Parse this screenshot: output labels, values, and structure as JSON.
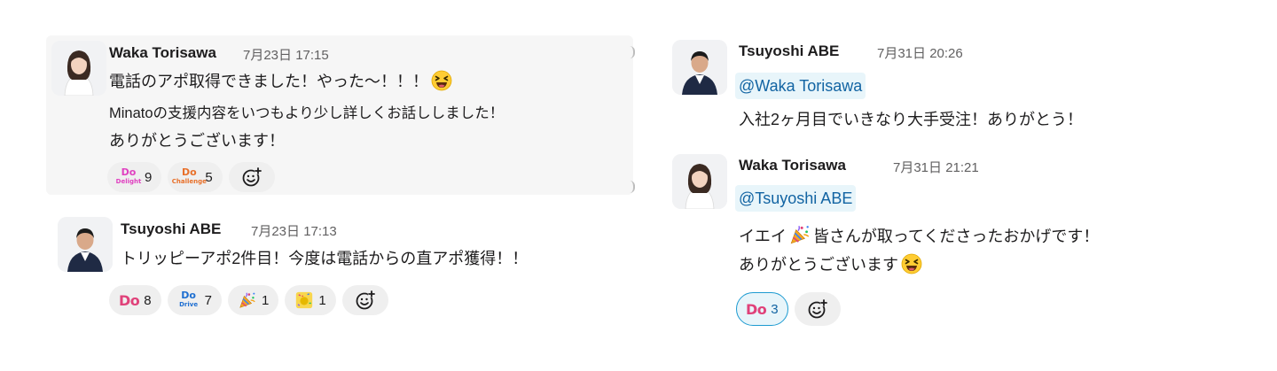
{
  "messages": [
    {
      "author": "Waka Torisawa",
      "time": "7月23日 17:15",
      "lines": [
        "電話のアポ取得できました！やった〜！！！",
        "Minatoの支援内容をいつもより少し詳しくお話ししました！",
        "ありがとうございます！"
      ],
      "reactions": [
        {
          "emoji": "do-delight",
          "label_top": "Do",
          "label_bottom": "Delight",
          "count": "9",
          "color": "#e040c0"
        },
        {
          "emoji": "do-challenge",
          "label_top": "Do",
          "label_bottom": "Challenge",
          "count": "5",
          "color": "#e8702a"
        }
      ]
    },
    {
      "author": "Tsuyoshi ABE",
      "time": "7月23日 17:13",
      "lines": [
        "トリッピーアポ2件目！今度は電話からの直アポ獲得！！"
      ],
      "reactions": [
        {
          "emoji": "do",
          "label_top": "Do",
          "count": "8",
          "color": "#e0427a"
        },
        {
          "emoji": "do-drive",
          "label_top": "Do",
          "label_bottom": "Drive",
          "count": "7",
          "color": "#1f6fd1"
        },
        {
          "emoji": "party-popper",
          "count": "1"
        },
        {
          "emoji": "confetti-ball",
          "count": "1"
        }
      ]
    },
    {
      "author": "Tsuyoshi ABE",
      "time": "7月31日 20:26",
      "mention": "@Waka Torisawa",
      "lines": [
        "入社2ヶ月目でいきなり大手受注！ありがとう！"
      ]
    },
    {
      "author": "Waka Torisawa",
      "time": "7月31日 21:21",
      "mention": "@Tsuyoshi ABE",
      "lines": [
        "イエイ",
        "皆さんが取ってくださったおかげです！",
        "ありがとうございます"
      ],
      "reactions": [
        {
          "emoji": "do",
          "label_top": "Do",
          "count": "3",
          "color": "#e0427a",
          "active": true
        }
      ]
    }
  ],
  "icons": {
    "grinning_squint": "grinning-squinting-face-icon",
    "add_reaction": "add-reaction-icon",
    "party": "party-popper-icon"
  },
  "colors": {
    "mention_text": "#1264a3",
    "mention_bg": "#e8f5fa",
    "active_border": "#1d9bd1",
    "highlight": "#f6f6f6"
  }
}
